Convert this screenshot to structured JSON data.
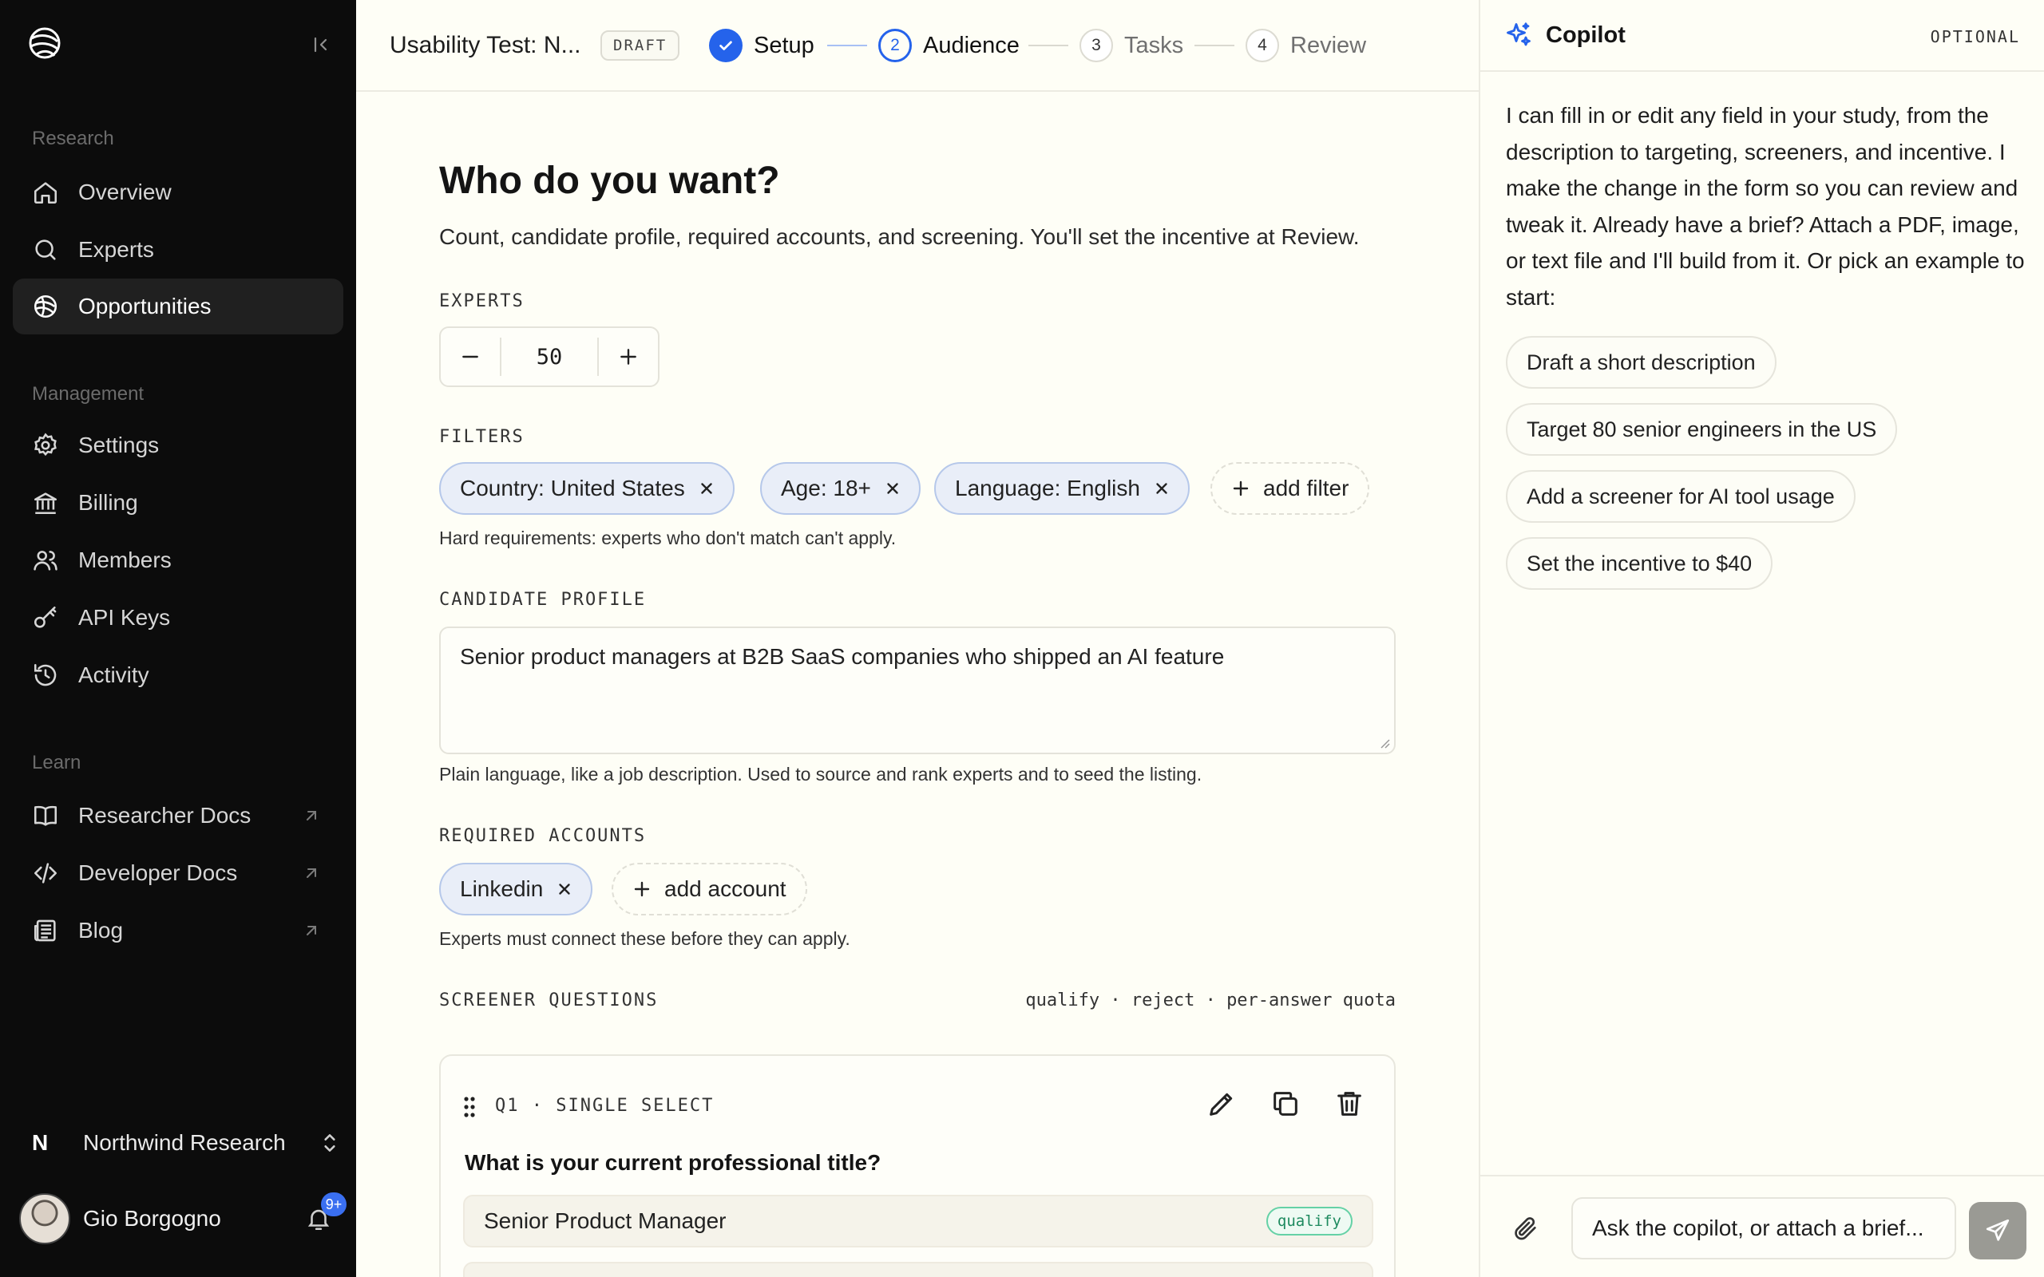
{
  "sidebar": {
    "sections": [
      {
        "label": "Research"
      },
      {
        "label": "Management"
      },
      {
        "label": "Learn"
      }
    ],
    "items": [
      {
        "label": "Overview",
        "icon": "home-icon"
      },
      {
        "label": "Experts",
        "icon": "search-icon"
      },
      {
        "label": "Opportunities",
        "icon": "globe-icon",
        "active": true
      },
      {
        "label": "Settings",
        "icon": "gear-icon"
      },
      {
        "label": "Billing",
        "icon": "bank-icon"
      },
      {
        "label": "Members",
        "icon": "users-icon"
      },
      {
        "label": "API Keys",
        "icon": "key-icon"
      },
      {
        "label": "Activity",
        "icon": "history-icon"
      },
      {
        "label": "Researcher Docs",
        "icon": "book-icon",
        "external": true
      },
      {
        "label": "Developer Docs",
        "icon": "code-icon",
        "external": true
      },
      {
        "label": "Blog",
        "icon": "newspaper-icon",
        "external": true
      }
    ],
    "org": {
      "initial": "N",
      "name": "Northwind Research"
    },
    "user": {
      "name": "Gio Borgogno",
      "notifications": "9+"
    }
  },
  "header": {
    "study_title": "Usability Test: N...",
    "status": "DRAFT",
    "steps": [
      {
        "number": "",
        "label": "Setup",
        "state": "done"
      },
      {
        "number": "2",
        "label": "Audience",
        "state": "current"
      },
      {
        "number": "3",
        "label": "Tasks",
        "state": "todo"
      },
      {
        "number": "4",
        "label": "Review",
        "state": "todo"
      }
    ]
  },
  "main": {
    "title": "Who do you want?",
    "subtitle": "Count, candidate profile, required accounts, and screening. You'll set the incentive at Review.",
    "experts": {
      "label": "EXPERTS",
      "value": "50"
    },
    "filters": {
      "label": "FILTERS",
      "chips": [
        "Country: United States",
        "Age: 18+",
        "Language: English"
      ],
      "add_label": "add filter",
      "hint": "Hard requirements: experts who don't match can't apply."
    },
    "profile": {
      "label": "CANDIDATE PROFILE",
      "value": "Senior product managers at B2B SaaS companies who shipped an AI feature",
      "hint": "Plain language, like a job description. Used to source and rank experts and to seed the listing."
    },
    "accounts": {
      "label": "REQUIRED ACCOUNTS",
      "chips": [
        "Linkedin"
      ],
      "add_label": "add account",
      "hint": "Experts must connect these before they can apply."
    },
    "screener": {
      "label": "SCREENER QUESTIONS",
      "meta": "qualify · reject · per-answer quota",
      "question": {
        "label": "Q1 · SINGLE SELECT",
        "text": "What is your current professional title?",
        "options": [
          {
            "label": "Senior Product Manager",
            "tag": "qualify"
          }
        ]
      }
    }
  },
  "copilot": {
    "title": "Copilot",
    "badge": "OPTIONAL",
    "message": "I can fill in or edit any field in your study, from the description to targeting, screeners, and incentive. I make the change in the form so you can review and tweak it. Already have a brief? Attach a PDF, image, or text file and I'll build from it. Or pick an example to start:",
    "suggestions": [
      "Draft a short description",
      "Target 80 senior engineers in the US",
      "Add a screener for AI tool usage",
      "Set the incentive to $40"
    ],
    "input_placeholder": "Ask the copilot, or attach a brief..."
  },
  "colors": {
    "accent": "#2563eb",
    "sidebar_bg": "#0c0c0c",
    "page_bg": "#fefef6",
    "chip_bg": "#e9eef8",
    "qualify": "#1e8a5f"
  }
}
